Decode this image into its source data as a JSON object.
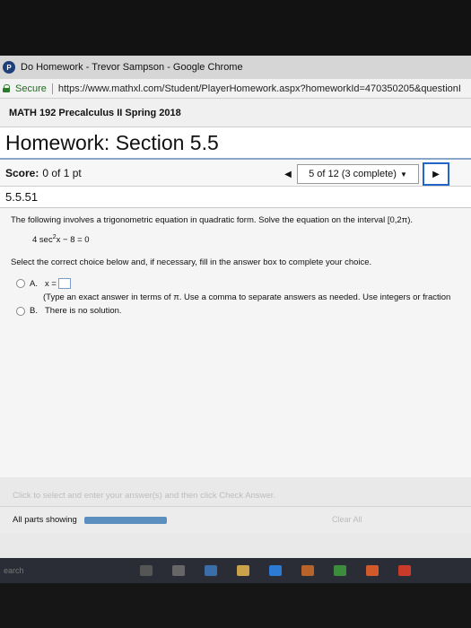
{
  "browser": {
    "window_title": "Do Homework - Trevor Sampson - Google Chrome",
    "security_label": "Secure",
    "url": "https://www.mathxl.com/Student/PlayerHomework.aspx?homeworkId=470350205&questionI"
  },
  "course": {
    "title": "MATH 192 Precalculus II Spring 2018"
  },
  "homework": {
    "title": "Homework: Section 5.5",
    "score_label": "Score:",
    "score_value": "0 of 1 pt",
    "progress": "5 of 12 (3 complete)",
    "question_number": "5.5.51"
  },
  "question": {
    "text": "The following involves a trigonometric equation in quadratic form. Solve the equation on the interval [0,2π).",
    "equation_pre": "4 sec",
    "equation_exp": "2",
    "equation_post": "x − 8 = 0",
    "instruction": "Select the correct choice below and, if necessary, fill in the answer box to complete your choice.",
    "choice_a_letter": "A.",
    "choice_a_text": "x =",
    "choice_a_hint": "(Type an exact answer in terms of π. Use a comma to separate answers as needed. Use integers or fraction",
    "choice_b_letter": "B.",
    "choice_b_text": "There is no solution."
  },
  "footer": {
    "help_text": "Click to select and enter your answer(s) and then click Check Answer.",
    "parts_label": "All parts showing",
    "clear_all": "Clear All"
  },
  "taskbar": {
    "search_placeholder": "earch"
  },
  "colors": {
    "accent_blue": "#2266cc",
    "parts_bar": "#5b8fbf"
  }
}
